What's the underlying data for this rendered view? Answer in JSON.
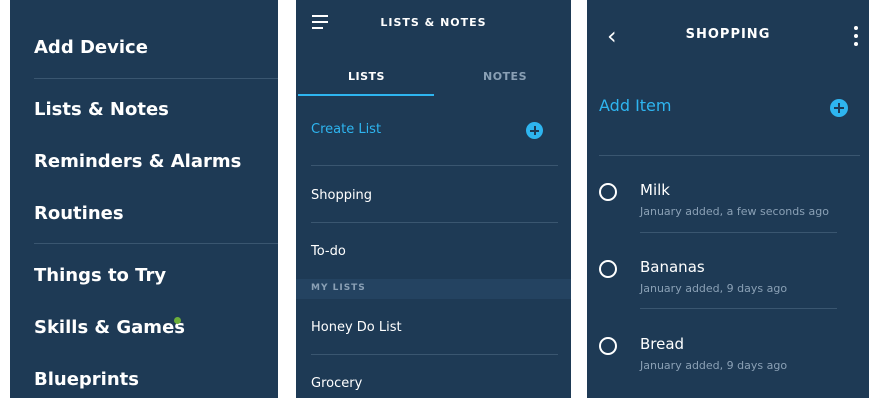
{
  "menu": {
    "items": [
      {
        "label": "Add Device"
      },
      {
        "label": "Lists & Notes"
      },
      {
        "label": "Reminders & Alarms"
      },
      {
        "label": "Routines"
      },
      {
        "label": "Things to Try"
      },
      {
        "label": "Skills & Games"
      },
      {
        "label": "Blueprints"
      }
    ]
  },
  "lists_screen": {
    "title": "LISTS & NOTES",
    "tabs": [
      {
        "label": "LISTS"
      },
      {
        "label": "NOTES"
      }
    ],
    "create_list": "Create List",
    "rows": [
      {
        "label": "Shopping"
      },
      {
        "label": "To-do"
      }
    ],
    "section_label": "MY LISTS",
    "my_lists": [
      {
        "label": "Honey Do List"
      },
      {
        "label": "Grocery"
      }
    ]
  },
  "shopping_screen": {
    "title": "SHOPPING",
    "add_item": "Add Item",
    "items": [
      {
        "name": "Milk",
        "meta": "January added, a few seconds ago"
      },
      {
        "name": "Bananas",
        "meta": "January added, 9 days ago"
      },
      {
        "name": "Bread",
        "meta": "January added, 9 days ago"
      }
    ]
  },
  "colors": {
    "background": "#1e3a55",
    "accent": "#2eb5f0",
    "badge": "#6cae3a"
  }
}
